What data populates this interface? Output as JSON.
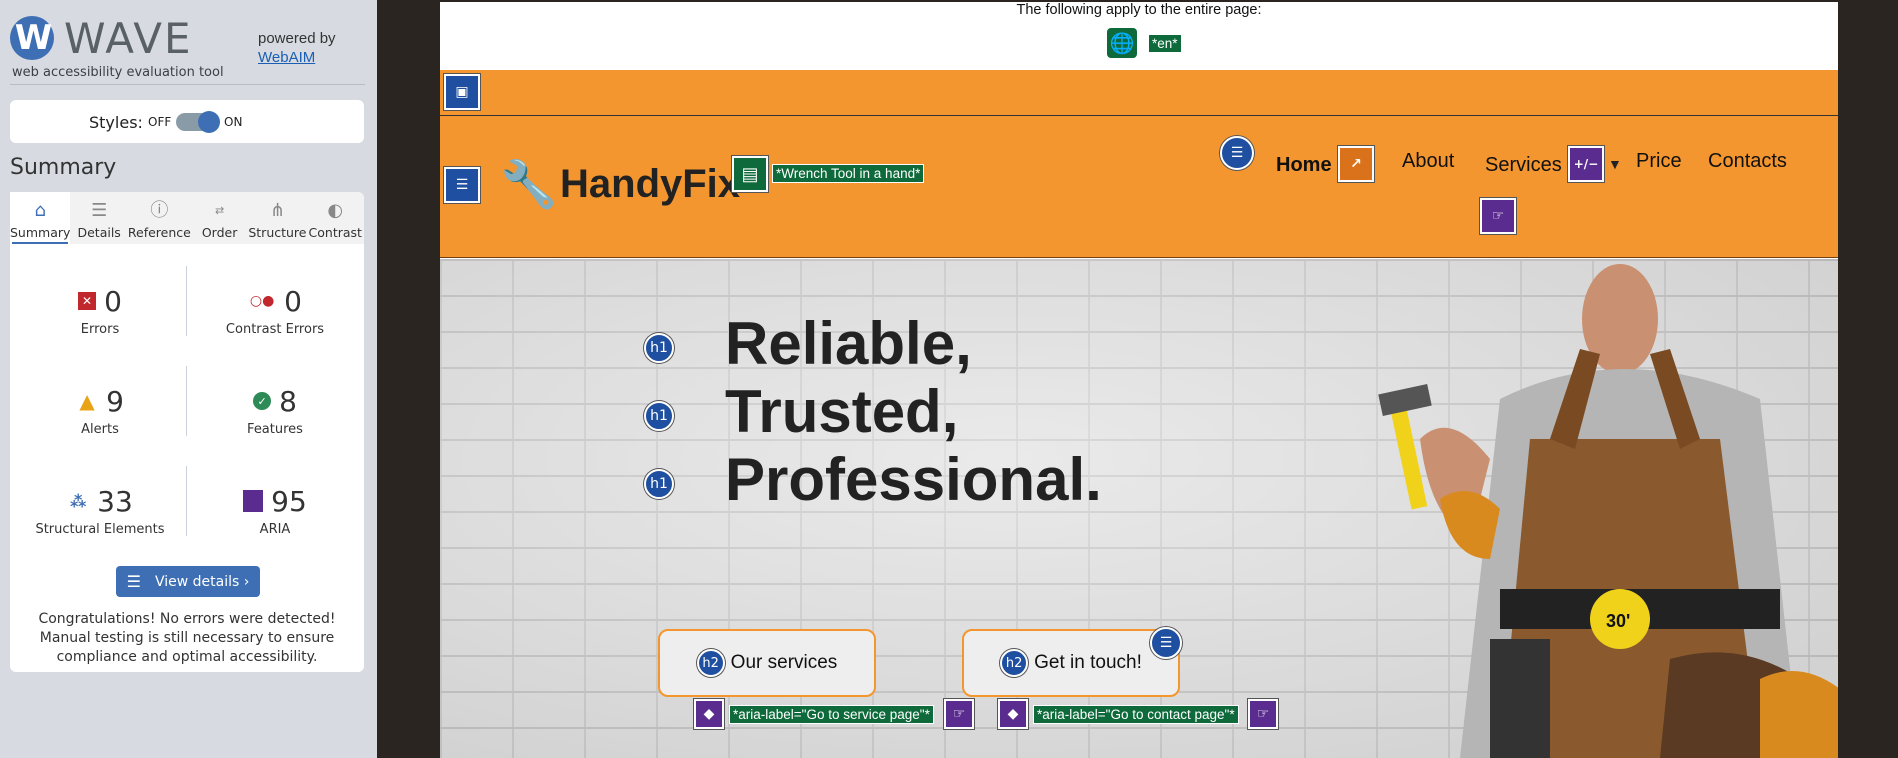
{
  "wave": {
    "logo_letter": "W",
    "title": "WAVE",
    "subtitle": "web accessibility evaluation tool",
    "powered_by": "powered by",
    "webaim_link": "WebAIM",
    "styles_label": "Styles:",
    "styles_off": "OFF",
    "styles_on": "ON",
    "styles_state": "on",
    "summary_heading": "Summary",
    "tabs": [
      {
        "label": "Summary",
        "icon": "home-icon",
        "active": true
      },
      {
        "label": "Details",
        "icon": "list-icon",
        "active": false
      },
      {
        "label": "Reference",
        "icon": "info-icon",
        "active": false
      },
      {
        "label": "Order",
        "icon": "order-icon",
        "active": false
      },
      {
        "label": "Structure",
        "icon": "structure-icon",
        "active": false
      },
      {
        "label": "Contrast",
        "icon": "contrast-icon",
        "active": false
      }
    ],
    "stats": {
      "errors": {
        "count": "0",
        "label": "Errors"
      },
      "contrast_errors": {
        "count": "0",
        "label": "Contrast Errors"
      },
      "alerts": {
        "count": "9",
        "label": "Alerts"
      },
      "features": {
        "count": "8",
        "label": "Features"
      },
      "structural": {
        "count": "33",
        "label": "Structural Elements"
      },
      "aria": {
        "count": "95",
        "label": "ARIA"
      }
    },
    "view_details": "View details ›",
    "congrats": "Congratulations! No errors were detected! Manual testing is still necessary to ensure compliance and optimal accessibility.",
    "colors": {
      "accent": "#3e6fb4",
      "error": "#c0282d",
      "alert": "#e8a317",
      "feature": "#2e8b57",
      "aria": "#5b2c8f"
    }
  },
  "page": {
    "page_wide_text": "The following apply to the entire page:",
    "lang_tag": "*en*",
    "brand": "HandyFix",
    "logo_alt_tag": "*Wrench Tool in a hand*",
    "nav": {
      "home": "Home",
      "about": "About",
      "services": "Services",
      "price": "Price",
      "contacts": "Contacts"
    },
    "hero_lines": [
      "Reliable,",
      "Trusted,",
      "Professional."
    ],
    "h1_badge": "h1",
    "h2_badge": "h2",
    "buttons": {
      "services": "Our services",
      "contact": "Get in touch!"
    },
    "aria_labels": {
      "services": "*aria-label=\"Go to service page\"*",
      "contact": "*aria-label=\"Go to contact page\"*"
    },
    "badge_text": {
      "aria_toggle": "+/−",
      "tape": "30'"
    },
    "colors": {
      "header": "#f4962f",
      "wave_green": "#0e6a3a",
      "wave_blue": "#1f4fa0",
      "wave_purple": "#5b2c8f"
    }
  }
}
